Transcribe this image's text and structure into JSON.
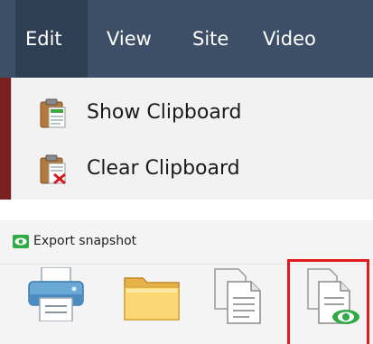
{
  "menubar": {
    "items": [
      {
        "label": "Edit",
        "active": true
      },
      {
        "label": "View"
      },
      {
        "label": "Site"
      },
      {
        "label": "Video"
      }
    ]
  },
  "edit_menu": {
    "items": [
      {
        "label": "Show Clipboard",
        "icon": "clipboard-icon"
      },
      {
        "label": "Clear Clipboard",
        "icon": "clipboard-clear-icon"
      }
    ]
  },
  "toolbar": {
    "title": "Export snapshot",
    "title_icon": "eye-icon",
    "buttons": [
      {
        "icon": "printer-icon"
      },
      {
        "icon": "folder-icon"
      },
      {
        "icon": "copy-pages-icon"
      },
      {
        "icon": "view-pages-icon",
        "highlighted": true
      }
    ]
  },
  "colors": {
    "menubar": "#3d4f66",
    "menubar_active": "#2e3e53",
    "dropdown": "#f2f2f2",
    "highlight": "#e31b1b",
    "eye_green": "#2faa45"
  }
}
